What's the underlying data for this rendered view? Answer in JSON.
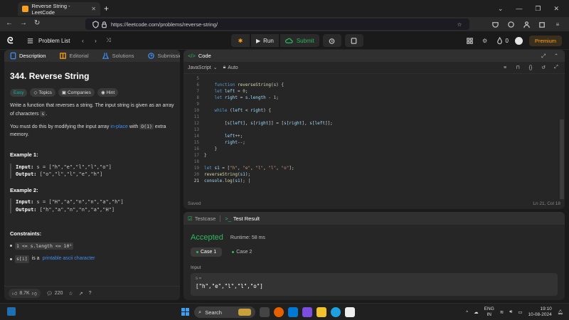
{
  "browser": {
    "tab_title": "Reverse String - LeetCode",
    "url": "https://leetcode.com/problems/reverse-string/"
  },
  "nav": {
    "problem_list": "Problem List",
    "run": "Run",
    "submit": "Submit",
    "streak": "0",
    "premium": "Premium"
  },
  "problem": {
    "tabs": [
      "Description",
      "Editorial",
      "Solutions",
      "Submissions"
    ],
    "title": "344. Reverse String",
    "tags": [
      "Easy",
      "Topics",
      "Companies",
      "Hint"
    ],
    "desc1": "Write a function that reverses a string. The input string is given as an array of characters",
    "desc1_code": "s",
    "desc2a": "You must do this by modifying the input array",
    "desc2_link": "in-place",
    "desc2b": "with",
    "desc2_code": "O(1)",
    "desc2c": "extra memory.",
    "ex1_title": "Example 1:",
    "ex1_input_label": "Input:",
    "ex1_input": "s = [\"h\",\"e\",\"l\",\"l\",\"o\"]",
    "ex1_output_label": "Output:",
    "ex1_output": "[\"o\",\"l\",\"l\",\"e\",\"h\"]",
    "ex2_title": "Example 2:",
    "ex2_input_label": "Input:",
    "ex2_input": "s = [\"H\",\"a\",\"n\",\"n\",\"a\",\"h\"]",
    "ex2_output_label": "Output:",
    "ex2_output": "[\"h\",\"a\",\"n\",\"n\",\"a\",\"H\"]",
    "constraints_title": "Constraints:",
    "c1_code": "1 <= s.length <= 10⁵",
    "c2_code": "s[i]",
    "c2_text": "is a",
    "c2_link": "printable ascii character",
    "likes": "8.7K",
    "comments": "220"
  },
  "code": {
    "title": "Code",
    "language": "JavaScript",
    "mode": "Auto",
    "saved": "Saved",
    "cursor": "Ln 21, Col 18"
  },
  "result": {
    "tab1": "Testcase",
    "tab2": "Test Result",
    "status": "Accepted",
    "runtime": "Runtime: 58 ms",
    "case1": "Case 1",
    "case2": "Case 2",
    "input_label": "Input",
    "var": "s =",
    "value": "[\"h\",\"e\",\"l\",\"l\",\"o\"]"
  },
  "taskbar": {
    "search": "Search",
    "lang1": "ENG",
    "lang2": "IN",
    "time": "19:10",
    "date": "10-08-2024"
  }
}
